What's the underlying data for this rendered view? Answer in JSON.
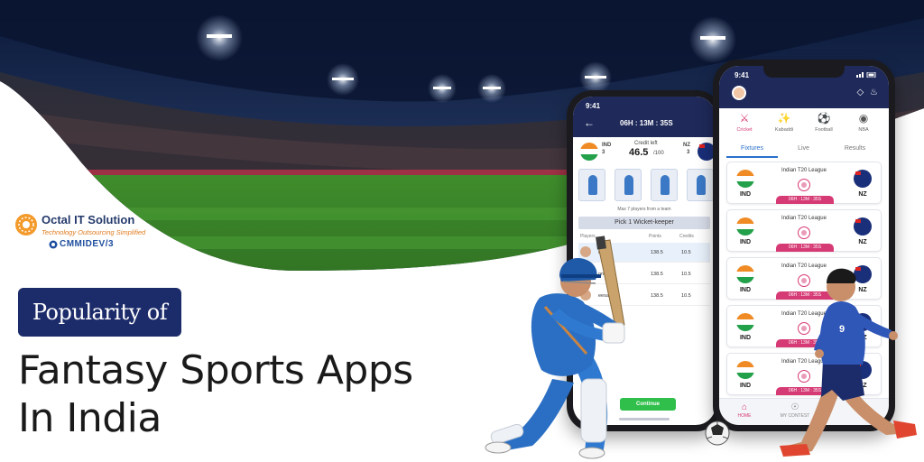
{
  "brand": {
    "name": "Octal IT Solution",
    "tagline": "Technology Outsourcing Simplified",
    "cmmi": "CMMIDEV/3"
  },
  "headline": {
    "pill": "Popularity of",
    "line1": "Fantasy Sports Apps",
    "line2": "In India"
  },
  "phone_back": {
    "time": "9:41",
    "timer": "06H : 13M : 35S",
    "team1": "IND",
    "team1_count": "3",
    "team2": "NZ",
    "team2_count": "3",
    "credit_label": "Credit left",
    "credit_value": "46.5",
    "credit_total": "/100",
    "hint": "Max 7 players from a team",
    "pick": "Pick 1 Wicket-keeper",
    "col_players": "Players",
    "col_points": "Points",
    "col_credits": "Credits",
    "rows": [
      {
        "name": "ttier",
        "points": "138.5",
        "credits": "10.5"
      },
      {
        "name": "oni",
        "points": "138.5",
        "credits": "10.5"
      },
      {
        "name": "eesan",
        "points": "138.5",
        "credits": "10.5"
      }
    ],
    "continue_label": "Continue"
  },
  "phone_front": {
    "time": "9:41",
    "sports": [
      "Cricket",
      "Kabaddi",
      "Football",
      "NBA"
    ],
    "tabs": [
      "Fixtures",
      "Live",
      "Results"
    ],
    "matches": [
      {
        "league": "Indian T20 League",
        "team1": "IND",
        "team2": "NZ",
        "time": "06H : 13M : 35S"
      },
      {
        "league": "Indian T20 League",
        "team1": "IND",
        "team2": "NZ",
        "time": "06H : 13M : 35S"
      },
      {
        "league": "Indian T20 League",
        "team1": "IND",
        "team2": "NZ",
        "time": "06H : 13M : 35S"
      },
      {
        "league": "Indian T20 League",
        "team1": "IND",
        "team2": "NZ",
        "time": "06H : 13M : 35S"
      },
      {
        "league": "Indian T20 League",
        "team1": "IND",
        "team2": "NZ",
        "time": "06H : 13M : 35S"
      }
    ],
    "nav": [
      "HOME",
      "MY CONTEST"
    ]
  },
  "colors": {
    "navy": "#1c2c6a",
    "accent_pink": "#d63a74",
    "accent_blue": "#2a6fc9",
    "continue_green": "#2fbf4a",
    "brand_orange": "#e07b1f"
  },
  "icons": [
    "octal-logo-icon",
    "cmmi-icon",
    "cricket-icon",
    "kabaddi-icon",
    "football-icon",
    "nba-icon",
    "wallet-icon",
    "bell-icon",
    "home-icon",
    "trophy-icon",
    "back-arrow-icon"
  ]
}
